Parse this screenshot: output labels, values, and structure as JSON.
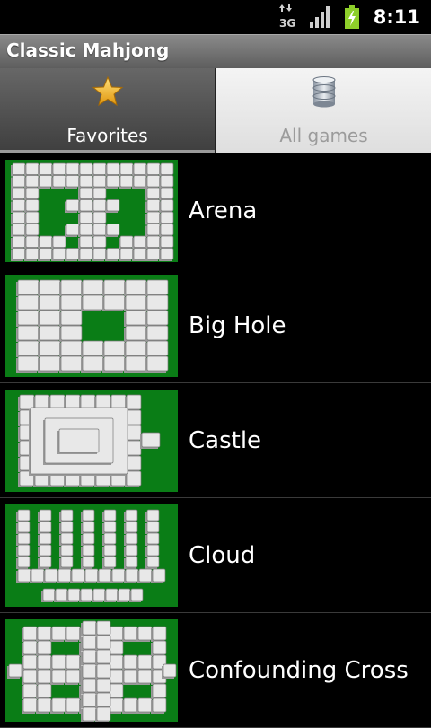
{
  "status_bar": {
    "time": "8:11",
    "network_label": "3G",
    "network_icon": "3g-data-icon",
    "signal_icon": "signal-icon",
    "battery_icon": "battery-charging-icon"
  },
  "app": {
    "title": "Classic Mahjong"
  },
  "tabs": [
    {
      "label": "Favorites",
      "icon": "star-icon",
      "selected": true
    },
    {
      "label": "All games",
      "icon": "database-icon",
      "selected": false
    }
  ],
  "games": [
    {
      "name": "Arena",
      "thumb_icon": "arena-layout-thumbnail"
    },
    {
      "name": "Big Hole",
      "thumb_icon": "big-hole-layout-thumbnail"
    },
    {
      "name": "Castle",
      "thumb_icon": "castle-layout-thumbnail"
    },
    {
      "name": "Cloud",
      "thumb_icon": "cloud-layout-thumbnail"
    },
    {
      "name": "Confounding Cross",
      "thumb_icon": "confounding-cross-layout-thumbnail"
    }
  ],
  "colors": {
    "board_green": "#0a7d16",
    "tile_face": "#e8e8e8",
    "tile_edge": "#7a7a7a"
  }
}
